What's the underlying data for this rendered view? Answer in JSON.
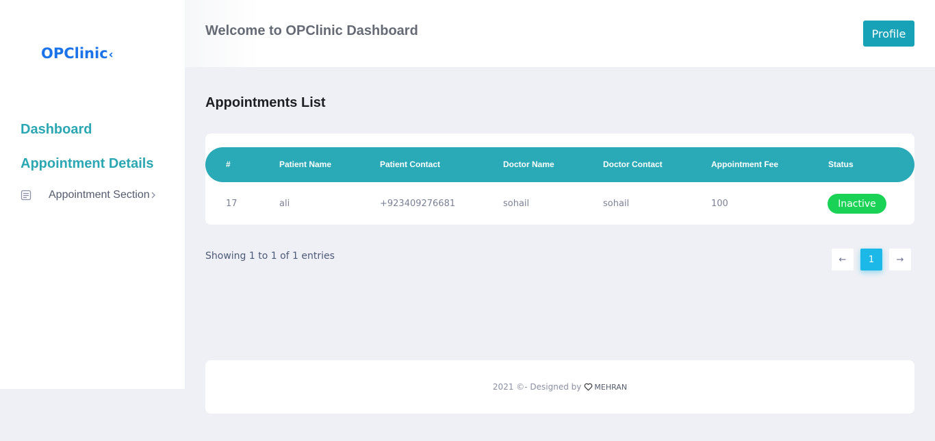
{
  "sidebar": {
    "logo": "OPClinic",
    "logo_suffix": "‹",
    "nav": {
      "dashboard": "Dashboard",
      "appointment_details": "Appointment Details",
      "appointment_section": "Appointment Section"
    }
  },
  "header": {
    "title": "Welcome to OPClinic Dashboard",
    "profile_label": "Profile"
  },
  "main": {
    "title": "Appointments List",
    "table": {
      "columns": [
        "#",
        "Patient Name",
        "Patient Contact",
        "Doctor Name",
        "Doctor Contact",
        "Appointment Fee",
        "Status"
      ],
      "rows": [
        [
          "17",
          "ali",
          "+923409276681",
          "sohail",
          "sohail",
          "100",
          "Inactive"
        ]
      ]
    },
    "entries_info": "Showing 1 to 1 of 1 entries",
    "pagination": {
      "prev": "←",
      "current": "1",
      "next": "→"
    }
  },
  "footer": {
    "text": "2021 ©- Designed by",
    "author": "MEHRAN"
  },
  "colors": {
    "accent": "#2aa9b7",
    "profile": "#17a2b8",
    "status_inactive": "#1ad356",
    "page_active": "#1cb8e7",
    "logo": "#1a73e8"
  }
}
